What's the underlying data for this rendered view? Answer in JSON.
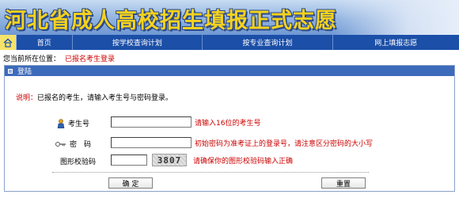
{
  "banner": {
    "title": "河北省成人高校招生填报正式志愿"
  },
  "nav": {
    "items": [
      "首页",
      "按学校查询计划",
      "按专业查询计划",
      "网上填报志愿"
    ]
  },
  "location": {
    "prefix": "您当前所在位置：",
    "current": "已报名考生登录"
  },
  "panel": {
    "title": "登陆"
  },
  "note": {
    "label": "说明：",
    "text": "已报名的考生，请输入考生号与密码登录。"
  },
  "form": {
    "exam_no": {
      "label": "考生号",
      "value": "",
      "hint": "请输入16位的考生号"
    },
    "password": {
      "label": "密　码",
      "value": "",
      "hint": "初始密码为准考证上的登录号，请注意区分密码的大小写"
    },
    "captcha": {
      "label": "图形校验码",
      "value": "",
      "code": "3807",
      "hint": "请确保你的图形校验码输入正确"
    }
  },
  "buttons": {
    "confirm": "确 定",
    "reset": "重置"
  },
  "colors": {
    "nav_bg": "#1b4fa8",
    "hint_red": "#cc0000",
    "panel_header": "#3d6bbb"
  }
}
